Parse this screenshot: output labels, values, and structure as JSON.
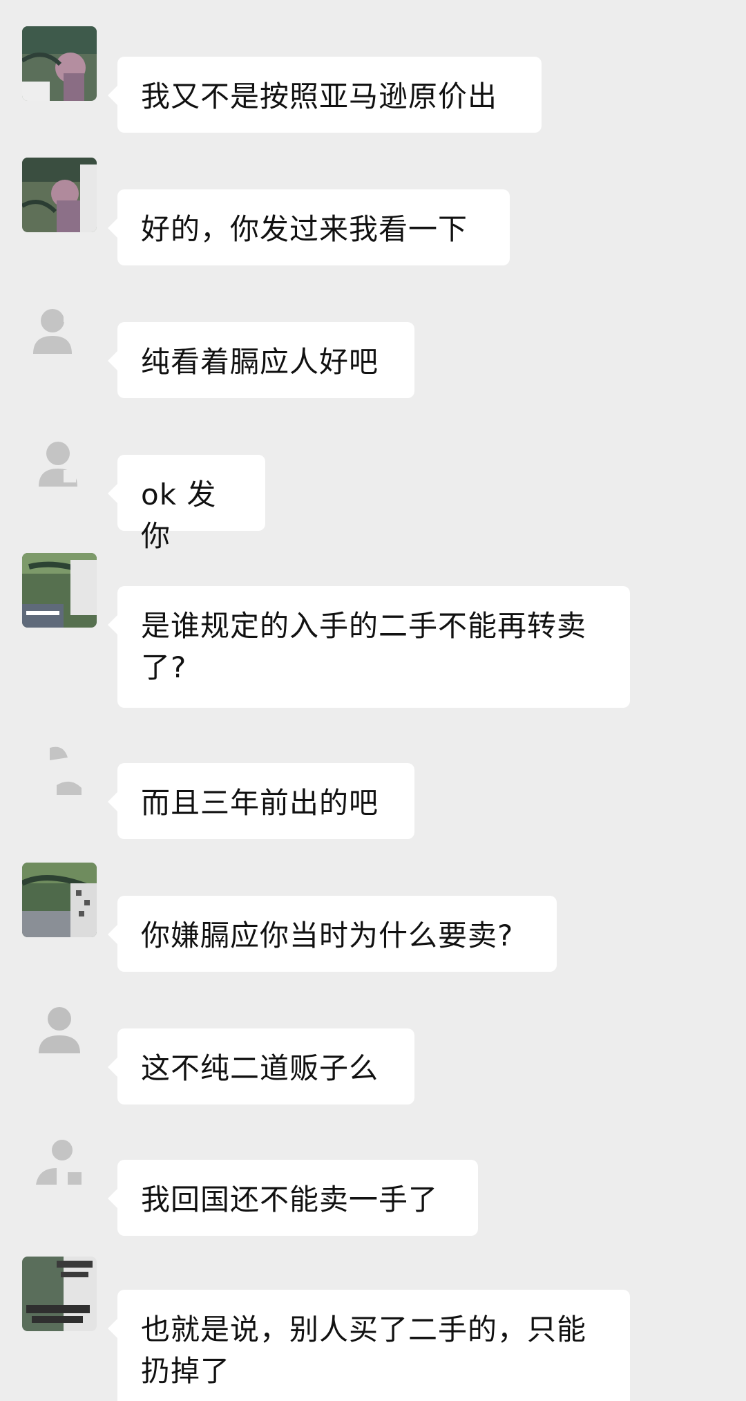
{
  "chat": {
    "messages": [
      {
        "avatar": "photo-avatar-icon",
        "text": "我又不是按照亚马逊原价出"
      },
      {
        "avatar": "photo-avatar-icon",
        "text": "好的，你发过来我看一下"
      },
      {
        "avatar": "default-person-avatar-icon",
        "text": "纯看着膈应人好吧"
      },
      {
        "avatar": "default-person-avatar-icon",
        "text": "ok 发你"
      },
      {
        "avatar": "photo-avatar-icon",
        "text": "是谁规定的入手的二手不能再转卖了?"
      },
      {
        "avatar": "default-person-avatar-icon",
        "text": "而且三年前出的吧"
      },
      {
        "avatar": "photo-avatar-icon",
        "text": "你嫌膈应你当时为什么要卖?"
      },
      {
        "avatar": "default-person-avatar-icon",
        "text": "这不纯二道贩子么"
      },
      {
        "avatar": "default-person-avatar-icon",
        "text": "我回国还不能卖一手了"
      },
      {
        "avatar": "photo-avatar-icon",
        "text": "也就是说，别人买了二手的，只能扔掉了"
      }
    ]
  },
  "colors": {
    "background": "#ededed",
    "bubble": "#ffffff",
    "text": "#111111"
  }
}
